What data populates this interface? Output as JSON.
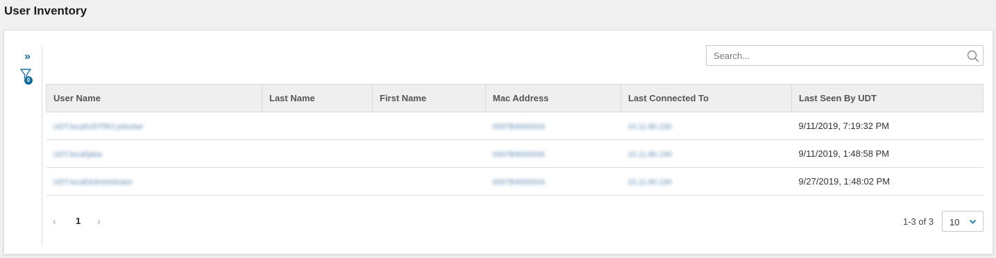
{
  "page": {
    "title": "User Inventory"
  },
  "sidebar": {
    "filter_count": "0"
  },
  "search": {
    "placeholder": "Search...",
    "value": ""
  },
  "table": {
    "columns": [
      "User Name",
      "Last Name",
      "First Name",
      "Mac Address",
      "Last Connected To",
      "Last Seen By UDT"
    ],
    "rows": [
      {
        "user_name": "UDT.local\\UDTRO.jntscker",
        "last_name": "",
        "first_name": "",
        "mac": "0007B400000A",
        "connected": "10.11.80.230",
        "last_seen": "9/11/2019, 7:19:32 PM"
      },
      {
        "user_name": "UDT.local\\jdoe",
        "last_name": "",
        "first_name": "",
        "mac": "0007B400000A",
        "connected": "10.11.80.190",
        "last_seen": "9/11/2019, 1:48:58 PM"
      },
      {
        "user_name": "UDT.local\\Administrator",
        "last_name": "",
        "first_name": "",
        "mac": "0007B400000A",
        "connected": "10.11.80.190",
        "last_seen": "9/27/2019, 1:48:02 PM"
      }
    ]
  },
  "pager": {
    "current_page": "1",
    "range": "1-3 of 3",
    "page_size": "10"
  },
  "colors": {
    "accent": "#0f6ba0",
    "header_bg": "#efefef"
  },
  "icons": {
    "expand": "double-chevron-right-icon",
    "filter": "filter-icon",
    "search": "search-icon",
    "prev": "chevron-left-icon",
    "next": "chevron-right-icon",
    "dropdown": "chevron-down-icon"
  }
}
